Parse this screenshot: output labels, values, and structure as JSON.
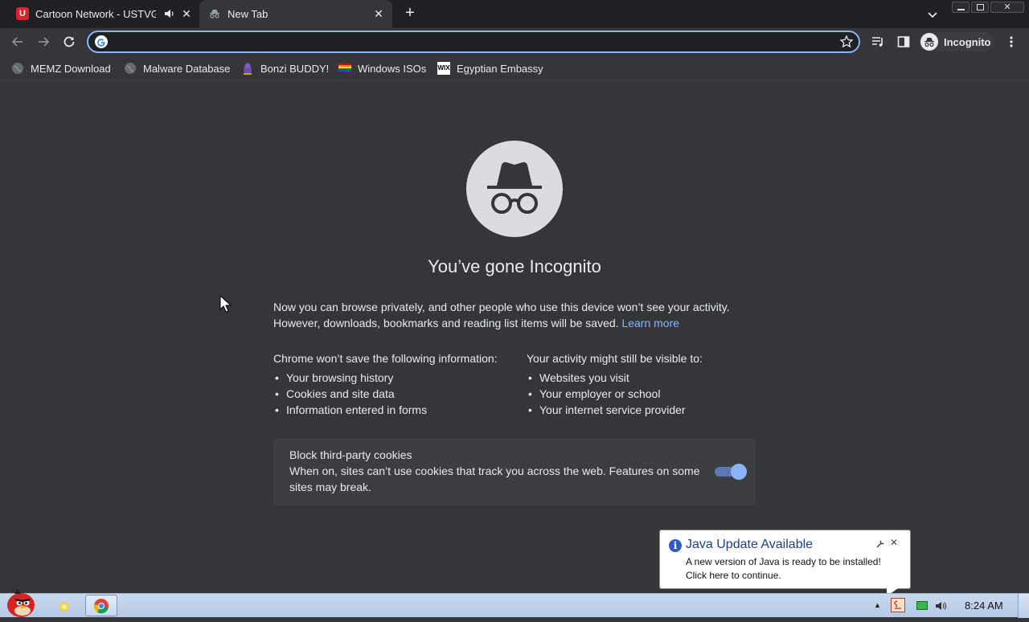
{
  "tabs": [
    {
      "title": "Cartoon Network - USTVG",
      "active": false,
      "audio": true
    },
    {
      "title": "New Tab",
      "active": true
    }
  ],
  "toolbar": {
    "omnibox_value": "",
    "profile_label": "Incognito"
  },
  "bookmarks": [
    {
      "label": "MEMZ Download",
      "icon": "globe-icon"
    },
    {
      "label": "Malware Database",
      "icon": "globe-icon"
    },
    {
      "label": "Bonzi BUDDY!",
      "icon": "bonzi-icon"
    },
    {
      "label": "Windows ISOs",
      "icon": "rainbow-flag-icon"
    },
    {
      "label": "Egyptian Embassy",
      "icon": "wix-icon"
    }
  ],
  "ntp": {
    "heading": "You’ve gone Incognito",
    "intro_line1": "Now you can browse privately, and other people who use this device won’t see your activity.",
    "intro_line2": "However, downloads, bookmarks and reading list items will be saved.",
    "learn_more": "Learn more",
    "not_saved_title": "Chrome won’t save the following information:",
    "not_saved_items": [
      "Your browsing history",
      "Cookies and site data",
      "Information entered in forms"
    ],
    "visible_title": "Your activity might still be visible to:",
    "visible_items": [
      "Websites you visit",
      "Your employer or school",
      "Your internet service provider"
    ],
    "cookie_title": "Block third-party cookies",
    "cookie_desc_line1": "When on, sites can’t use cookies that track you across the web. Features on some",
    "cookie_desc_line2": "sites may break.",
    "cookie_toggle_on": true
  },
  "java_balloon": {
    "title": "Java Update Available",
    "line1": "A new version of Java is ready to be installed!",
    "line2": "Click here to continue."
  },
  "taskbar": {
    "clock": "8:24 AM"
  },
  "colors": {
    "accent": "#8ab4f8",
    "background": "#35363a",
    "tabstrip": "#202124"
  }
}
